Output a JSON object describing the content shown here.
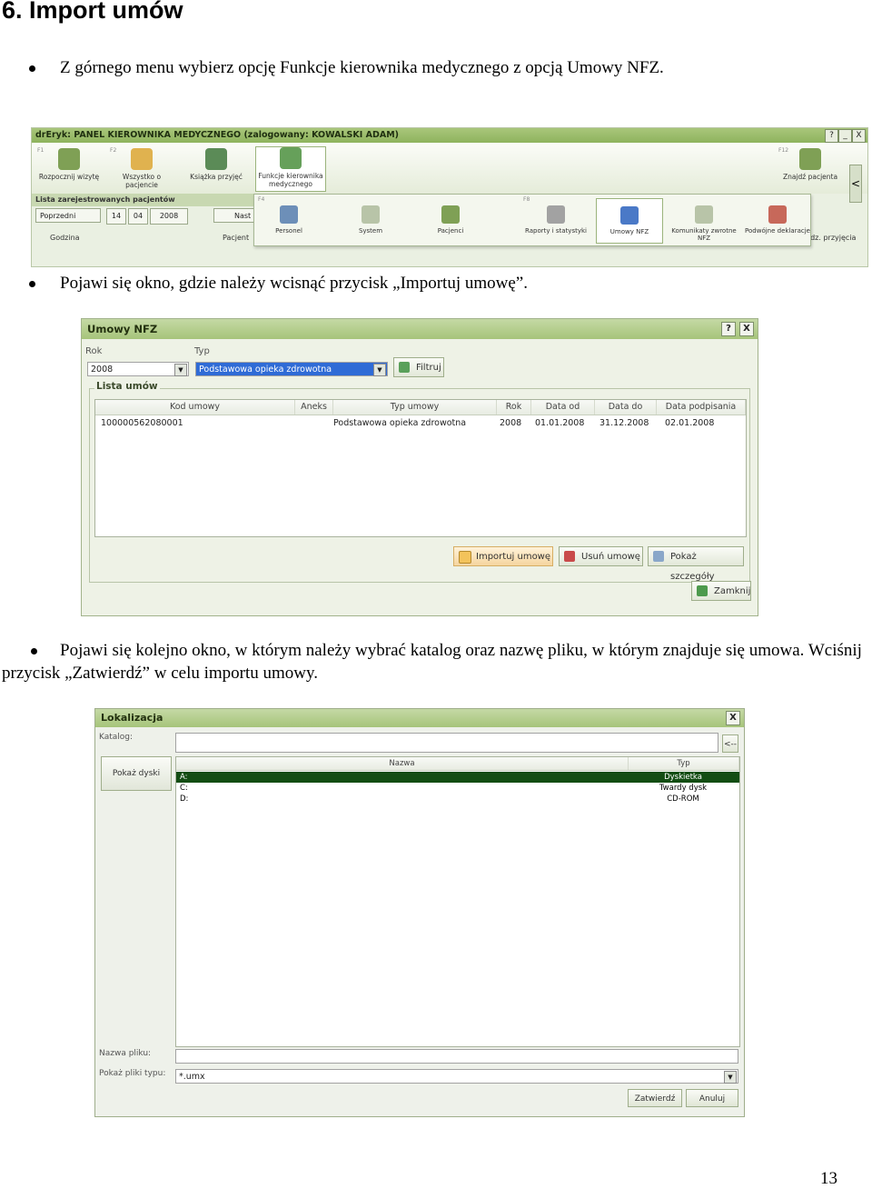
{
  "heading": "6. Import umów",
  "bullets": [
    "Z górnego menu wybierz opcję Funkcje kierownika medycznego z opcją Umowy NFZ.",
    "Pojawi się okno, gdzie należy wcisnąć przycisk „Importuj umowę”.",
    "Pojawi się kolejno okno, w którym należy wybrać katalog oraz nazwę pliku, w którym znajduje się umowa. Wciśnij przycisk „Zatwierdź” w celu importu umowy."
  ],
  "shot1": {
    "title": "drEryk: PANEL KIEROWNIKA MEDYCZNEGO (zalogowany: KOWALSKI ADAM)",
    "help": "?",
    "minimize": "_",
    "close": "X",
    "fkeys": [
      "F1",
      "F2",
      "F4",
      "F8",
      "F12"
    ],
    "tools": [
      {
        "label": "Rozpocznij wizytę"
      },
      {
        "label": "Wszystko o pacjencie"
      },
      {
        "label": "Książka przyjęć"
      },
      {
        "label": "Funkcje kierownika medycznego"
      },
      {
        "label": "Znajdź pacjenta"
      }
    ],
    "list_header": "Lista zarejestrowanych pacjentów",
    "prev": "Poprzedni",
    "day": "14",
    "month": "04",
    "year": "2008",
    "next": "Nast",
    "col_time": "Godzina",
    "col_patient": "Pacjent",
    "col_reception": "Godz. przyjęcia",
    "menu": [
      "Personel",
      "System",
      "Pacjenci",
      "Raporty i statystyki",
      "Umowy NFZ",
      "Komunikaty zwrotne NFZ",
      "Podwójne deklaracje"
    ],
    "nav_arrow": "<"
  },
  "shot2": {
    "title": "Umowy NFZ",
    "help": "?",
    "close": "X",
    "year_label": "Rok",
    "year_value": "2008",
    "type_label": "Typ",
    "type_value": "Podstawowa opieka zdrowotna",
    "filter": "Filtruj",
    "group_title": "Lista umów",
    "columns": [
      "Kod umowy",
      "Aneks",
      "Typ umowy",
      "Rok",
      "Data od",
      "Data do",
      "Data podpisania"
    ],
    "rows": [
      [
        "100000562080001",
        "",
        "Podstawowa opieka zdrowotna",
        "2008",
        "01.01.2008",
        "31.12.2008",
        "02.01.2008"
      ]
    ],
    "import_btn": "Importuj umowę",
    "delete_btn": "Usuń umowę",
    "details_btn": "Pokaż szczegóły",
    "close_btn": "Zamknij"
  },
  "shot3": {
    "title": "Lokalizacja",
    "close": "X",
    "catalog_label": "Katalog:",
    "back_btn": "<--",
    "show_disks": "Pokaż dyski",
    "col_name": "Nazwa",
    "col_type": "Typ",
    "rows": [
      {
        "name": "A:",
        "type": "Dyskietka"
      },
      {
        "name": "C:",
        "type": "Twardy dysk"
      },
      {
        "name": "D:",
        "type": "CD-ROM"
      }
    ],
    "filename_label": "Nazwa pliku:",
    "filetype_label": "Pokaż pliki typu:",
    "filetype_value": "*.umx",
    "confirm": "Zatwierdź",
    "cancel": "Anuluj"
  },
  "page_number": "13",
  "colors": {
    "titlebar_green": "#a6c47a",
    "selection_green": "#134d13",
    "selection_blue": "#2f6bd6"
  }
}
